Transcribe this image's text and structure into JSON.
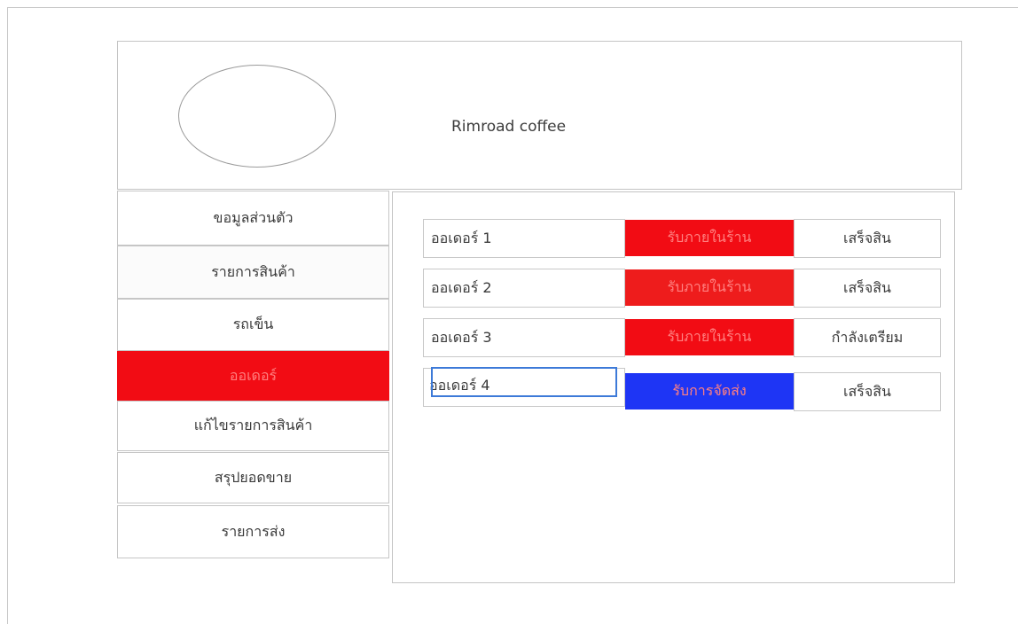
{
  "header": {
    "brand_name": "Rimroad coffee"
  },
  "sidebar": {
    "items": [
      {
        "label": "ขอมูลส่วนตัว",
        "active": false
      },
      {
        "label": "รายการสินค้า",
        "active": false
      },
      {
        "label": "รถเข็น",
        "active": false
      },
      {
        "label": "ออเดอร์",
        "active": true
      },
      {
        "label": "แก้ไขรายการสินค้า",
        "active": false
      },
      {
        "label": "สรุปยอดขาย",
        "active": false
      },
      {
        "label": "รายการส่ง",
        "active": false
      }
    ]
  },
  "orders": [
    {
      "name": "ออเดอร์ 1",
      "type": "รับภายในร้าน",
      "type_color": "#f20c14",
      "status": "เสร็จสิน"
    },
    {
      "name": "ออเดอร์ 2",
      "type": "รับภายในร้าน",
      "type_color": "#ee1c1c",
      "status": "เสร็จสิน"
    },
    {
      "name": "ออเดอร์ 3",
      "type": "รับภายในร้าน",
      "type_color": "#f20c14",
      "status": "กำลังเตรียม"
    },
    {
      "name": "ออเดอร์ 4",
      "type": "รับการจัดส่ง",
      "type_color": "#1e35f5",
      "status": "เสร็จสิน"
    }
  ],
  "colors": {
    "accent_red": "#f20c14",
    "accent_blue": "#1e35f5",
    "active_text": "#ff7f7f",
    "focus_ring": "#3d7ad8"
  }
}
